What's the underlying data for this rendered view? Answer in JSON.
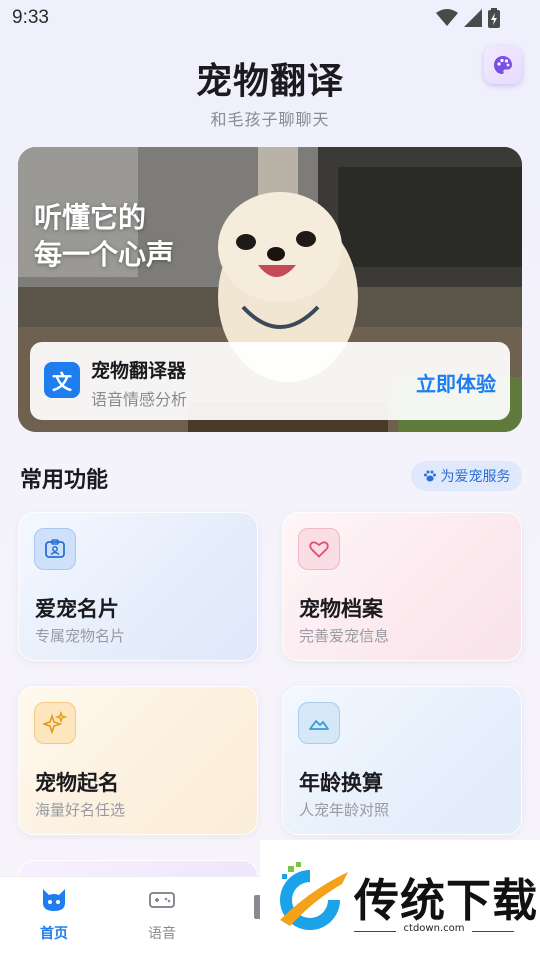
{
  "status_bar": {
    "time": "9:33"
  },
  "header": {
    "title": "宠物翻译",
    "subtitle": "和毛孩子聊聊天"
  },
  "banner": {
    "headline_line1": "听懂它的",
    "headline_line2": "每一个心声",
    "card": {
      "icon_text": "文",
      "title": "宠物翻译器",
      "description": "语音情感分析",
      "cta": "立即体验"
    }
  },
  "section": {
    "title": "常用功能",
    "badge": "为爱宠服务"
  },
  "features": [
    {
      "title": "爱宠名片",
      "desc": "专属宠物名片",
      "icon": "id-card-icon"
    },
    {
      "title": "宠物档案",
      "desc": "完善爱宠信息",
      "icon": "heart-icon"
    },
    {
      "title": "宠物起名",
      "desc": "海量好名任选",
      "icon": "sparkle-icon"
    },
    {
      "title": "年龄换算",
      "desc": "人宠年龄对照",
      "icon": "mountain-icon"
    }
  ],
  "bottom_nav": {
    "home": "首页",
    "voice": "语音"
  },
  "watermark": {
    "text": "传统下载",
    "url": "ctdown.com"
  },
  "colors": {
    "accent": "#1e7ef0",
    "background": "#eef0fb"
  }
}
